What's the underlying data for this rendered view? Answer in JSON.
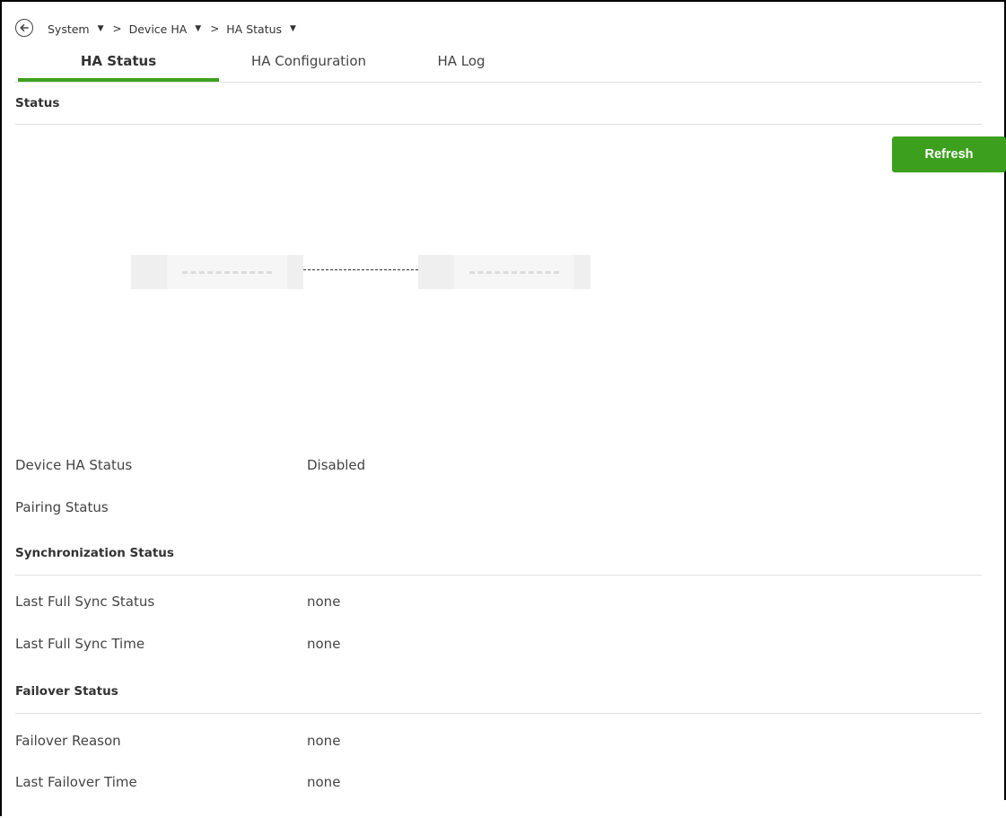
{
  "breadcrumb": {
    "items": [
      "System",
      "Device HA",
      "HA Status"
    ],
    "separator": ">"
  },
  "tabs": [
    {
      "label": "HA Status",
      "active": true
    },
    {
      "label": "HA Configuration",
      "active": false
    },
    {
      "label": "HA Log",
      "active": false
    }
  ],
  "sections": {
    "status": "Status",
    "sync": "Synchronization Status",
    "failover": "Failover Status"
  },
  "refresh_label": "Refresh",
  "status_rows": [
    {
      "label": "Device HA Status",
      "value": "Disabled"
    },
    {
      "label": "Pairing Status",
      "value": ""
    }
  ],
  "sync_rows": [
    {
      "label": "Last Full Sync Status",
      "value": "none"
    },
    {
      "label": "Last Full Sync Time",
      "value": "none"
    }
  ],
  "failover_rows": [
    {
      "label": "Failover Reason",
      "value": "none"
    },
    {
      "label": "Last Failover Time",
      "value": "none"
    }
  ],
  "colors": {
    "accent": "#3ca01e",
    "divider": "#e0e0e0",
    "node": "#efefef"
  },
  "icons": [
    "back-arrow-icon",
    "caret-down-icon"
  ]
}
